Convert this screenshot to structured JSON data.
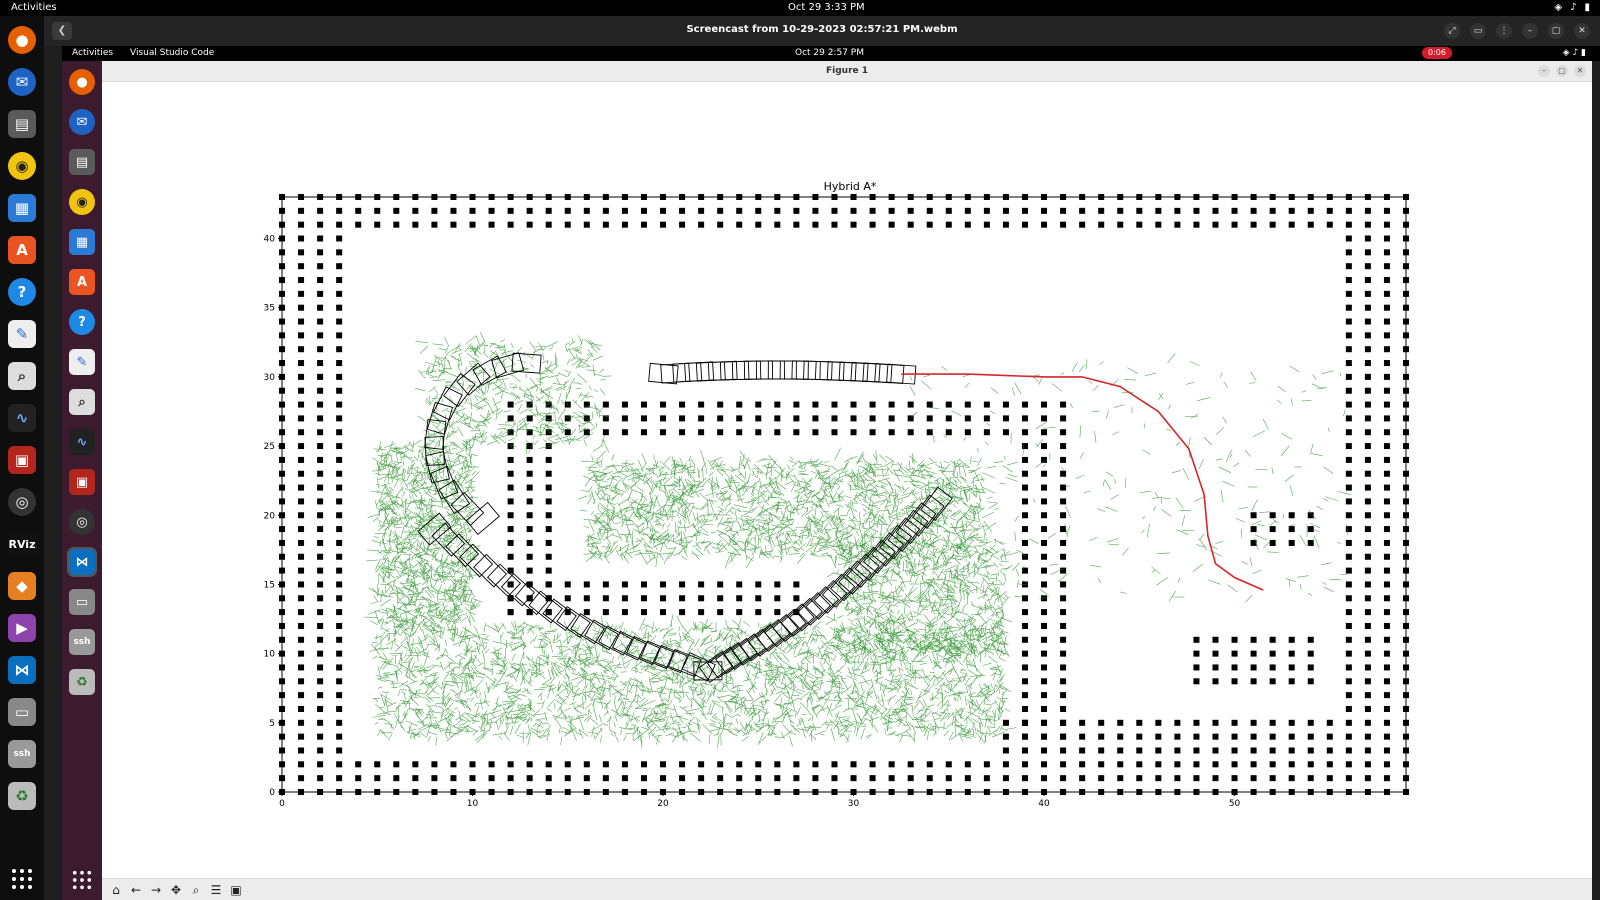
{
  "topbar": {
    "activities": "Activities",
    "clock": "Oct 29  3:33 PM"
  },
  "player": {
    "title": "Screencast from 10-29-2023 02:57:21 PM.webm"
  },
  "inner": {
    "activities": "Activities",
    "app": "Visual Studio Code",
    "clock": "Oct 29  2:57 PM",
    "rec": "0:06"
  },
  "figure": {
    "window_title": "Figure 1"
  },
  "chart_data": {
    "type": "scatter",
    "title": "Hybrid A*",
    "xlim": [
      0,
      59
    ],
    "ylim": [
      0,
      43
    ],
    "xticks": [
      0,
      10,
      20,
      30,
      40,
      50
    ],
    "yticks": [
      0,
      5,
      10,
      15,
      20,
      25,
      30,
      35,
      40
    ],
    "obstacles": [
      {
        "x": [
          0,
          59
        ],
        "y": [
          0,
          43
        ],
        "region": "outer border"
      },
      {
        "x": [
          12,
          41
        ],
        "y": [
          28,
          26
        ],
        "region": "inner top wall"
      }
    ],
    "path": {
      "color": "#d62728",
      "x": [
        32.5,
        36,
        40,
        42,
        44,
        46,
        47.6,
        48.4,
        48.6,
        49,
        50,
        51.5
      ],
      "y": [
        30.2,
        30.2,
        30.0,
        30.0,
        29.3,
        27.5,
        24.8,
        21.5,
        18.5,
        16.5,
        15.5,
        14.6
      ]
    },
    "explored_color": "#1a8a1a"
  },
  "toolbar": {
    "icons": [
      "home",
      "back",
      "forward",
      "pan",
      "zoom",
      "configure",
      "save"
    ]
  }
}
